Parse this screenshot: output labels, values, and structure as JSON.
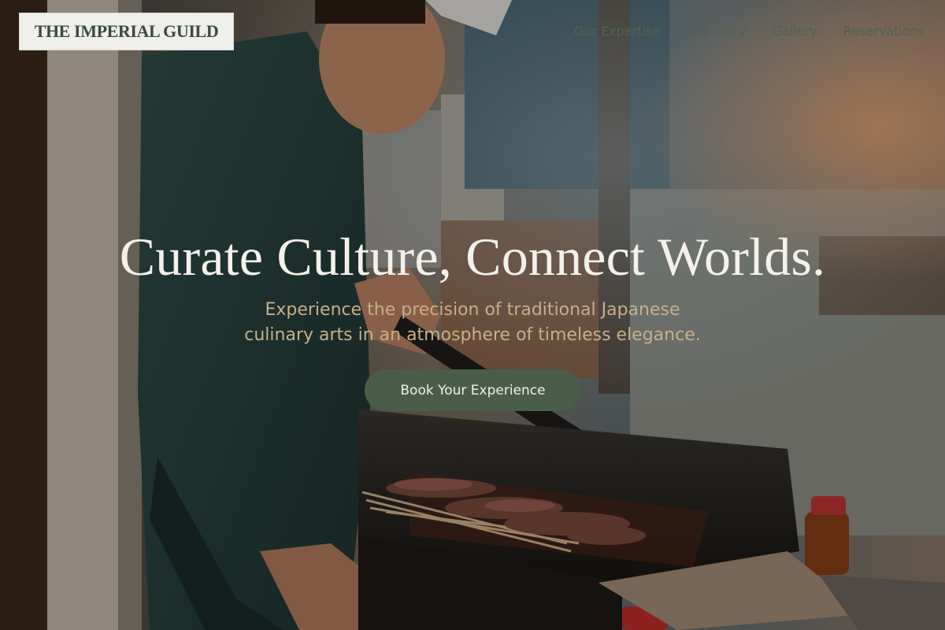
{
  "brand": {
    "name": "THE IMPERIAL GUILD"
  },
  "nav": {
    "items": [
      "Our Expertise",
      "Our Story",
      "Gallery",
      "Reservations"
    ]
  },
  "hero": {
    "headline": "Curate Culture, Connect Worlds.",
    "subline_line1": "Experience the precision of traditional Japanese",
    "subline_line2": "culinary arts in an atmosphere of timeless elegance.",
    "cta_label": "Book Your Experience",
    "image_subject": "chef grilling yakitori skewers over charcoal grill"
  },
  "colors": {
    "brand_green": "#4a5d49",
    "nav_text": "#4f6350",
    "subline_gold": "#c6b089",
    "headline_text": "#f4f1ea",
    "logo_background": "#eeeeea"
  }
}
